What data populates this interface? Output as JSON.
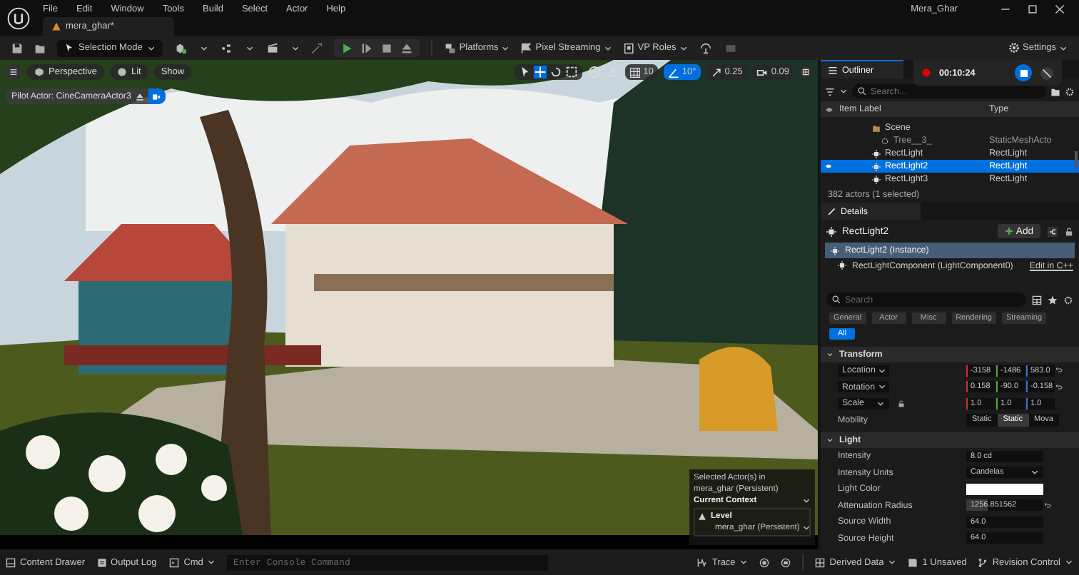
{
  "menu": [
    "File",
    "Edit",
    "Window",
    "Tools",
    "Build",
    "Select",
    "Actor",
    "Help"
  ],
  "window": {
    "title": "Mera_Ghar"
  },
  "document_tab": {
    "label": "mera_ghar*"
  },
  "toolbar": {
    "mode": "Selection Mode",
    "platforms": "Platforms",
    "pixel_streaming": "Pixel Streaming",
    "vp_roles": "VP Roles",
    "settings": "Settings"
  },
  "viewport": {
    "view": "Perspective",
    "lighting": "Lit",
    "show": "Show",
    "grid_snap": "10",
    "rotation_snap": "10°",
    "scale_snap": "0.25",
    "camera_speed": "0.09",
    "pilot_actor": "Pilot Actor: CineCameraActor3",
    "context": {
      "note": "Selected Actor(s) in",
      "note_level": "mera_ghar (Persistent)",
      "heading": "Current Context",
      "level_label": "Level",
      "level_value": "mera_ghar (Persistent)"
    }
  },
  "recording": {
    "time": "00:10:24"
  },
  "outliner": {
    "title": "Outliner",
    "search_placeholder": "Search...",
    "columns": [
      "Item Label",
      "Type"
    ],
    "rows": [
      {
        "kind": "folder",
        "label": "Scene",
        "selected": false
      },
      {
        "kind": "mesh",
        "label": "Tree__3_",
        "type": "StaticMeshActo",
        "selected": false
      },
      {
        "kind": "light",
        "label": "RectLight",
        "type": "RectLight",
        "selected": false
      },
      {
        "kind": "light",
        "label": "RectLight2",
        "type": "RectLight",
        "selected": true
      },
      {
        "kind": "light",
        "label": "RectLight3",
        "type": "RectLight",
        "selected": false
      }
    ],
    "count": "382 actors (1 selected)"
  },
  "details": {
    "title": "Details",
    "actor": "RectLight2",
    "add": "Add",
    "instance": "RectLight2 (Instance)",
    "component": "RectLightComponent (LightComponent0)",
    "edit": "Edit in C++",
    "search_placeholder": "Search",
    "filters": [
      {
        "label": "General",
        "selected": false
      },
      {
        "label": "Actor",
        "selected": false
      },
      {
        "label": "Misc",
        "selected": false
      },
      {
        "label": "Rendering",
        "selected": false
      },
      {
        "label": "Streaming",
        "selected": false
      },
      {
        "label": "All",
        "selected": true
      }
    ],
    "sections": [
      {
        "title": "Transform",
        "rows": [
          {
            "kind": "vector",
            "label": "Location",
            "values": [
              "-3158",
              "-1486",
              "583.0"
            ],
            "reset": true
          },
          {
            "kind": "vector",
            "label": "Rotation",
            "values": [
              "0.158",
              "-90.0",
              "-0.158"
            ],
            "reset": true
          },
          {
            "kind": "vector",
            "label": "Scale",
            "values": [
              "1.0",
              "1.0",
              "1.0"
            ],
            "reset": false
          },
          {
            "kind": "segmented",
            "label": "Mobility",
            "options": [
              {
                "label": "Static",
                "selected": false
              },
              {
                "label": "Static",
                "selected": true
              },
              {
                "label": "Mova",
                "selected": false
              }
            ]
          }
        ]
      },
      {
        "title": "Light",
        "rows": [
          {
            "kind": "text",
            "label": "Intensity",
            "value": "8.0 cd",
            "reset": false
          },
          {
            "kind": "dropdown",
            "label": "Intensity Units",
            "value": "Candelas"
          },
          {
            "kind": "color",
            "label": "Light Color",
            "color": "#ffffff"
          },
          {
            "kind": "slider",
            "label": "Attenuation Radius",
            "value": "1256.851562",
            "level": 0.28,
            "reset": true
          },
          {
            "kind": "text",
            "label": "Source Width",
            "value": "64.0",
            "reset": false
          },
          {
            "kind": "text",
            "label": "Source Height",
            "value": "64.0",
            "reset": false
          }
        ]
      }
    ]
  },
  "status_bar": {
    "content_drawer": "Content Drawer",
    "output_log": "Output Log",
    "cmd": "Cmd",
    "console_placeholder": "Enter Console Command",
    "trace": "Trace",
    "derived_data": "Derived Data",
    "unsaved": "1 Unsaved",
    "revision_control": "Revision Control"
  }
}
